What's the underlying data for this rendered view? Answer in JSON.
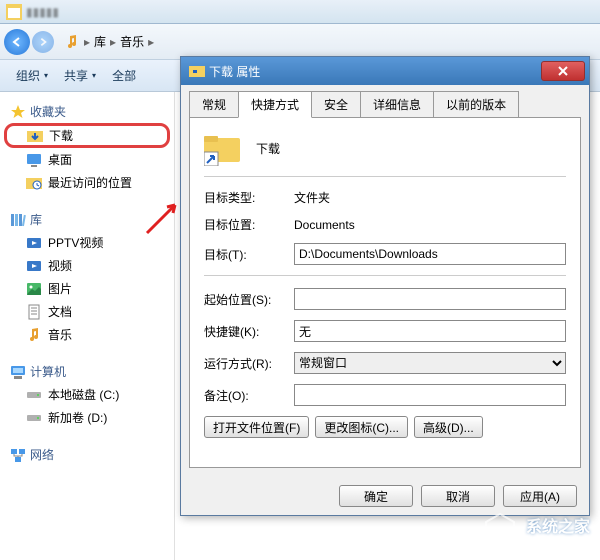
{
  "explorer": {
    "title": "音乐",
    "breadcrumb": {
      "lib": "库",
      "current": "音乐"
    },
    "toolbar": {
      "organize": "组织",
      "share": "共享",
      "all": "全部"
    },
    "sidebar": {
      "favorites": {
        "header": "收藏夹",
        "items": [
          "下载",
          "桌面",
          "最近访问的位置"
        ]
      },
      "libraries": {
        "header": "库",
        "items": [
          "PPTV视频",
          "视频",
          "图片",
          "文档",
          "音乐"
        ]
      },
      "computer": {
        "header": "计算机",
        "items": [
          "本地磁盘 (C:)",
          "新加卷 (D:)"
        ]
      },
      "network": {
        "header": "网络"
      }
    }
  },
  "dialog": {
    "title": "下载 属性",
    "tabs": [
      "常规",
      "快捷方式",
      "安全",
      "详细信息",
      "以前的版本"
    ],
    "heading": "下载",
    "fields": {
      "target_type_label": "目标类型:",
      "target_type_value": "文件夹",
      "target_loc_label": "目标位置:",
      "target_loc_value": "Documents",
      "target_label": "目标(T):",
      "target_value": "D:\\Documents\\Downloads",
      "startin_label": "起始位置(S):",
      "startin_value": "",
      "hotkey_label": "快捷键(K):",
      "hotkey_value": "无",
      "run_label": "运行方式(R):",
      "run_value": "常规窗口",
      "comment_label": "备注(O):",
      "comment_value": ""
    },
    "buttons": {
      "open_loc": "打开文件位置(F)",
      "change_icon": "更改图标(C)...",
      "advanced": "高级(D)...",
      "ok": "确定",
      "cancel": "取消",
      "apply": "应用(A)"
    }
  },
  "watermark": "系统之家"
}
